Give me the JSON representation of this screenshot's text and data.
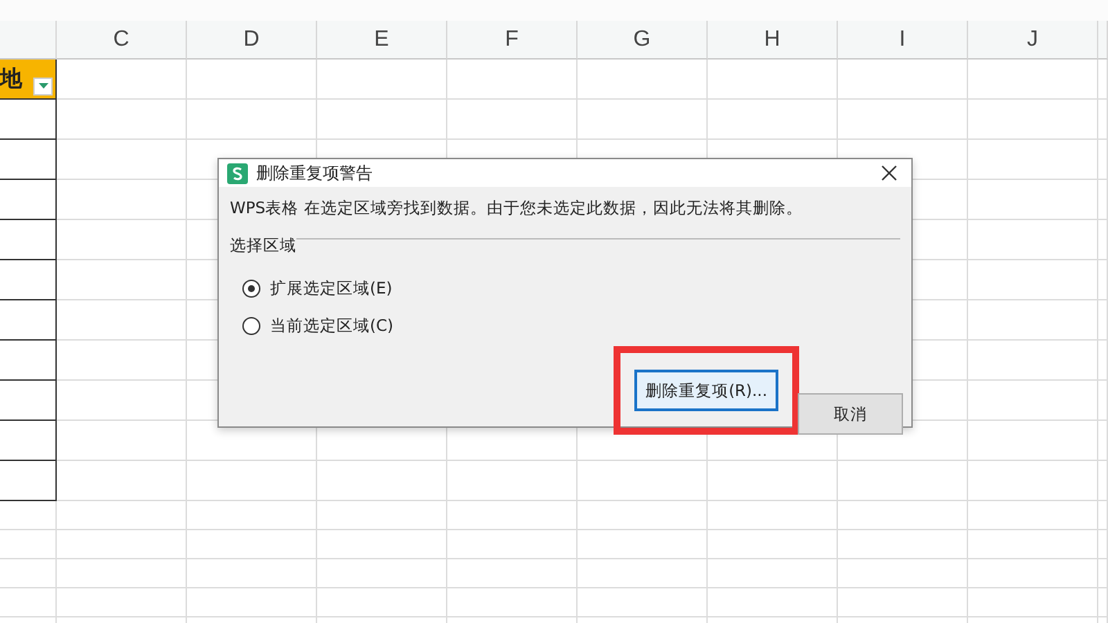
{
  "sheet": {
    "columns": [
      "C",
      "D",
      "E",
      "F",
      "G",
      "H",
      "I",
      "J"
    ],
    "header_cell": {
      "text": "地",
      "filter": true
    }
  },
  "dialog": {
    "title": "删除重复项警告",
    "message": "WPS表格 在选定区域旁找到数据。由于您未选定此数据，因此无法将其删除。",
    "group_label": "选择区域",
    "options": [
      {
        "label": "扩展选定区域(E)",
        "selected": true
      },
      {
        "label": "当前选定区域(C)",
        "selected": false
      }
    ],
    "buttons": [
      {
        "label": "删除重复项(R)...",
        "highlighted": true
      },
      {
        "label": "取消",
        "highlighted": false
      }
    ]
  }
}
